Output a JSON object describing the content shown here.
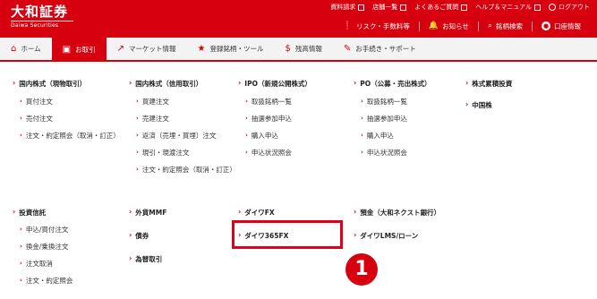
{
  "header": {
    "logo_main": "大和証券",
    "logo_sub": "Daiwa Securities",
    "util_links": [
      "資料請求",
      "店舗一覧",
      "よくあるご質問",
      "ヘルプ＆マニュアル",
      "ログアウト"
    ],
    "util2": [
      "リスク・手数料等",
      "お知らせ",
      "銘柄検索",
      "口座情報"
    ]
  },
  "nav": {
    "items": [
      "ホーム",
      "お取引",
      "マーケット情報",
      "登録銘柄・ツール",
      "残高情報",
      "お手続き・サポート"
    ],
    "active": "お取引"
  },
  "menu": {
    "c1": {
      "title": "国内株式（現物取引）",
      "items": [
        "買付注文",
        "売付注文",
        "注文・約定照会（取消・訂正）"
      ]
    },
    "c2": {
      "title": "国内株式（信用取引）",
      "items": [
        "買建注文",
        "売建注文",
        "返済（売埋・買埋）注文",
        "現引・現渡注文",
        "注文・約定照会（取消・訂正）"
      ]
    },
    "c3": {
      "title": "IPO（新規公開株式）",
      "items": [
        "取扱銘柄一覧",
        "抽選参加申込",
        "購入申込",
        "申込状況照会"
      ]
    },
    "c4": {
      "title": "PO（公募・売出株式）",
      "items": [
        "取扱銘柄一覧",
        "抽選参加申込",
        "購入申込",
        "申込状況照会"
      ]
    },
    "c5": {
      "items": [
        "株式累積投資",
        "中国株"
      ]
    },
    "r2c1": {
      "title": "投資信託",
      "items": [
        "申込/買付注文",
        "換金/乗換注文",
        "注文取消",
        "注文・約定照会"
      ]
    },
    "r2c2": {
      "items": [
        "外貨MMF",
        "債券",
        "為替取引"
      ]
    },
    "r2c3": {
      "items": [
        "ダイワFX",
        "ダイワ365FX"
      ]
    },
    "r2c4": {
      "items": [
        "預金（大和ネクスト銀行）",
        "ダイワLMS/ローン"
      ]
    }
  },
  "annotation": {
    "badge": "1"
  }
}
